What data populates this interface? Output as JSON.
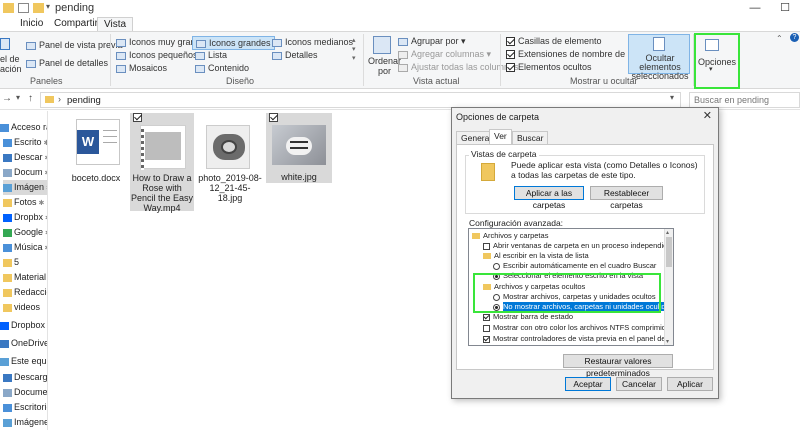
{
  "window": {
    "title": "pending"
  },
  "ribbon": {
    "tabs": [
      "Inicio",
      "Compartir",
      "Vista"
    ],
    "panes": {
      "nav_pane_label": "el de\nación",
      "preview": "Panel de vista previa",
      "details": "Panel de detalles",
      "group": "Paneles"
    },
    "layout": {
      "very_large": "Iconos muy grandes",
      "large": "Iconos grandes",
      "medium": "Iconos medianos",
      "small": "Iconos pequeños",
      "list": "Lista",
      "details": "Detalles",
      "tiles": "Mosaicos",
      "content": "Contenido",
      "group": "Diseño"
    },
    "current_view": {
      "sort_by": "Ordenar\npor",
      "group_by": "Agrupar por",
      "add_columns": "Agregar columnas",
      "fit_columns": "Ajustar todas las columnas",
      "group": "Vista actual"
    },
    "show_hide": {
      "item_checkboxes": "Casillas de elemento",
      "extensions": "Extensiones de nombre de archivo",
      "hidden_items": "Elementos ocultos",
      "hide_selected": "Ocultar elementos seleccionados",
      "group": "Mostrar u ocultar"
    },
    "options": "Opciones"
  },
  "address": {
    "path": "pending",
    "search_placeholder": "Buscar en pending"
  },
  "nav": [
    {
      "label": "Acceso rápi",
      "icon": "star-icon"
    },
    {
      "label": "Escrito",
      "icon": "desktop-icon"
    },
    {
      "label": "Descar",
      "icon": "download-icon"
    },
    {
      "label": "Docum",
      "icon": "document-icon"
    },
    {
      "label": "Imágen",
      "icon": "pictures-icon"
    },
    {
      "label": "Fotos",
      "icon": "folder-icon"
    },
    {
      "label": "Dropbx",
      "icon": "dropbox-icon"
    },
    {
      "label": "Google",
      "icon": "google-icon"
    },
    {
      "label": "Música",
      "icon": "music-icon"
    },
    {
      "label": "5",
      "icon": "folder-icon"
    },
    {
      "label": "Material r",
      "icon": "folder-icon"
    },
    {
      "label": "Redacción",
      "icon": "folder-icon"
    },
    {
      "label": "videos",
      "icon": "folder-icon"
    },
    {
      "label": "Dropbox",
      "icon": "dropbox-icon"
    },
    {
      "label": "OneDrive",
      "icon": "onedrive-icon"
    },
    {
      "label": "Este equipo",
      "icon": "computer-icon"
    },
    {
      "label": "Descargas",
      "icon": "download-icon"
    },
    {
      "label": "Documen",
      "icon": "document-icon"
    },
    {
      "label": "Escritorio",
      "icon": "desktop-icon"
    },
    {
      "label": "Imágenes",
      "icon": "pictures-icon"
    }
  ],
  "files": [
    {
      "name": "boceto.docx",
      "icon": "word-document-icon"
    },
    {
      "name": "How to Draw a Rose with Pencil the Easy Way.mp4",
      "icon": "video-file-icon"
    },
    {
      "name": "photo_2019-08-12_21-45-18.jpg",
      "icon": "telephone-photo-icon"
    },
    {
      "name": "white.jpg",
      "icon": "tiger-photo-icon"
    }
  ],
  "dialog": {
    "title": "Opciones de carpeta",
    "tabs": [
      "General",
      "Ver",
      "Buscar"
    ],
    "folder_views_legend": "Vistas de carpeta",
    "folder_views_desc": "Puede aplicar esta vista (como Detalles o Iconos) a todas las carpetas de este tipo.",
    "apply_folders": "Aplicar a las carpetas",
    "reset_folders": "Restablecer carpetas",
    "advanced_legend": "Configuración avanzada:",
    "tree": [
      {
        "type": "folder",
        "label": "Archivos y carpetas"
      },
      {
        "type": "check",
        "label": "Abrir ventanas de carpeta en un proceso independiente",
        "on": false
      },
      {
        "type": "folder",
        "label": "Al escribir en la vista de lista"
      },
      {
        "type": "radio",
        "label": "Escribir automáticamente en el cuadro Buscar",
        "on": false
      },
      {
        "type": "radio",
        "label": "Seleccionar el elemento escrito en la vista",
        "on": true
      },
      {
        "type": "folder",
        "label": "Archivos y carpetas ocultos"
      },
      {
        "type": "radio",
        "label": "Mostrar archivos, carpetas y unidades ocultos",
        "on": false
      },
      {
        "type": "radio",
        "label": "No mostrar archivos, carpetas ni unidades ocultos",
        "on": true
      },
      {
        "type": "check",
        "label": "Mostrar barra de estado",
        "on": true
      },
      {
        "type": "check",
        "label": "Mostrar con otro color los archivos NTFS comprimidos o c",
        "on": false
      },
      {
        "type": "check",
        "label": "Mostrar controladores de vista previa en el panel de vista",
        "on": true
      }
    ],
    "restore_defaults": "Restaurar valores predeterminados",
    "ok": "Aceptar",
    "cancel": "Cancelar",
    "apply": "Aplicar"
  },
  "colors": {
    "accent": "#0078d7",
    "highlight": "#39e53a",
    "file_tab": "#1a5fb4"
  }
}
